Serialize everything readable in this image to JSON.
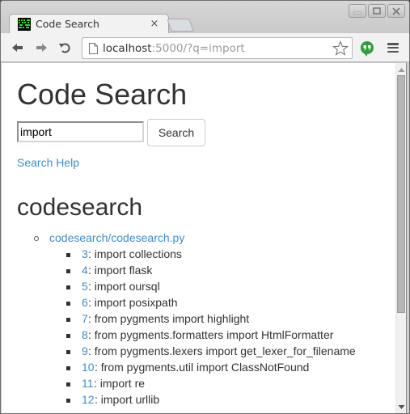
{
  "browser": {
    "tab_title": "Code Search",
    "tab_close": "×",
    "url_host": "localhost",
    "url_rest": ":5000/?q=import",
    "icons": {
      "favicon": "codesearch-favicon",
      "back": "arrow-left",
      "forward": "arrow-right",
      "reload": "reload",
      "page": "document",
      "bookmark": "star-outline",
      "extension": "hangouts-quote",
      "menu": "hamburger",
      "minimize": "minimize",
      "maximize": "maximize",
      "close": "close"
    }
  },
  "page": {
    "title": "Code Search",
    "search": {
      "value": "import",
      "placeholder": "",
      "button_label": "Search"
    },
    "help_link": "Search Help",
    "section_title": "codesearch",
    "file": {
      "path": "codesearch/codesearch.py",
      "matches": [
        {
          "line": "3",
          "sep": ": ",
          "code": "import collections"
        },
        {
          "line": "4",
          "sep": ": ",
          "code": "import flask"
        },
        {
          "line": "5",
          "sep": ": ",
          "code": "import oursql"
        },
        {
          "line": "6",
          "sep": ": ",
          "code": "import posixpath"
        },
        {
          "line": "7",
          "sep": ": ",
          "code": "from pygments import highlight"
        },
        {
          "line": "8",
          "sep": ": ",
          "code": "from pygments.formatters import HtmlFormatter"
        },
        {
          "line": "9",
          "sep": ": ",
          "code": "from pygments.lexers import get_lexer_for_filename"
        },
        {
          "line": "10",
          "sep": ": ",
          "code": "from pygments.util import ClassNotFound"
        },
        {
          "line": "11",
          "sep": ": ",
          "code": "import re"
        },
        {
          "line": "12",
          "sep": ": ",
          "code": "import urllib"
        }
      ]
    }
  },
  "colors": {
    "link": "#428bca",
    "text": "#333333"
  }
}
